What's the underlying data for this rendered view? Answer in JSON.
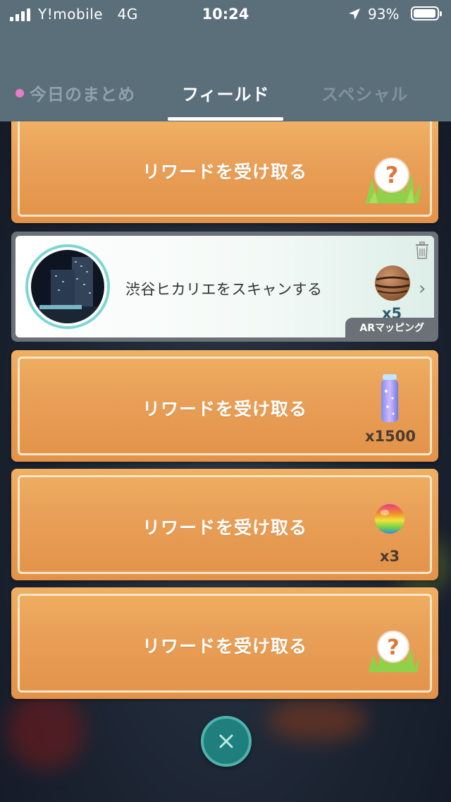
{
  "status_bar": {
    "carrier": "Y!mobile",
    "network": "4G",
    "time": "10:24",
    "battery_percent": "93%",
    "icons": [
      "signal-icon",
      "location-arrow-icon",
      "battery-icon"
    ]
  },
  "tabs": [
    {
      "label": "今日のまとめ",
      "active": false,
      "has_dot": true
    },
    {
      "label": "フィールド",
      "active": true
    },
    {
      "label": "スペシャル",
      "active": false
    }
  ],
  "cards": [
    {
      "label": "リワードを受け取る",
      "reward_icon": "mystery-encounter-icon",
      "qty": ""
    },
    {
      "label": "リワードを受け取る",
      "reward_icon": "stardust-icon",
      "qty": "x1500"
    },
    {
      "label": "リワードを受け取る",
      "reward_icon": "rare-candy-icon",
      "qty": "x3"
    },
    {
      "label": "リワードを受け取る",
      "reward_icon": "mystery-encounter-icon",
      "qty": ""
    }
  ],
  "quest": {
    "title": "渋谷ヒカリエをスキャンする",
    "reward_icon": "beast-ball-icon",
    "reward_qty": "x5",
    "badge": "ARマッピング",
    "mystery_mark": "?"
  },
  "colors": {
    "header": "#5b6f7b",
    "card_orange": "#e9a058",
    "active_tab": "#ffffff",
    "close_button": "#1f7f7d",
    "tab_dot": "#e57ec6"
  }
}
